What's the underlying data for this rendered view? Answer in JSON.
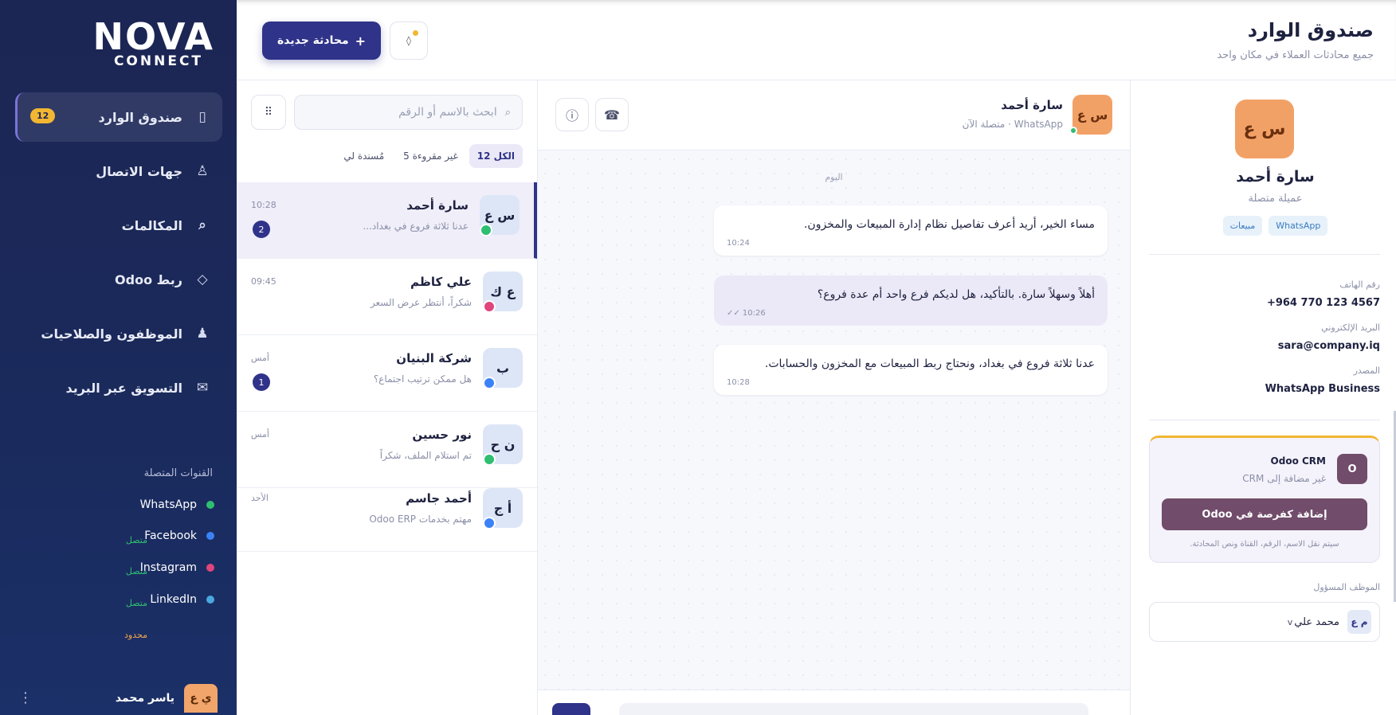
{
  "brand": {
    "line1": "NOVA",
    "line2": "CONNECT"
  },
  "nav": [
    {
      "label": "صندوق الوارد",
      "icon": "▯",
      "badge": "12",
      "active": true
    },
    {
      "label": "جهات الاتصال",
      "icon": "♙"
    },
    {
      "label": "المكالمات",
      "icon": "⌕"
    },
    {
      "label": "ربط Odoo",
      "icon": "◇"
    },
    {
      "label": "الموظفون والصلاحيات",
      "icon": "♟"
    },
    {
      "label": "التسويق عبر البريد",
      "icon": "✉"
    }
  ],
  "channels": {
    "title": "القنوات المتصلة",
    "items": [
      {
        "name": "WhatsApp",
        "status": "متصل",
        "color": "#2fbf71",
        "status_color": "#2fbf71"
      },
      {
        "name": "Facebook",
        "status": "متصل",
        "color": "#3b82f6",
        "status_color": "#2fbf71"
      },
      {
        "name": "Instagram",
        "status": "متصل",
        "color": "#e0457b",
        "status_color": "#2fbf71"
      },
      {
        "name": "LinkedIn",
        "status": "محدود",
        "color": "#4aa8e0",
        "status_color": "#f2a64a"
      }
    ]
  },
  "user": {
    "initials": "ي ع",
    "name": "ياسر محمد"
  },
  "header": {
    "title": "صندوق الوارد",
    "subtitle": "جميع محادثات العملاء في مكان واحد",
    "new_chat": "محادثة جديدة",
    "new_chat_icon": "+"
  },
  "conversations": {
    "search_placeholder": "ابحث بالاسم أو الرقم",
    "tabs": [
      {
        "label": "الكل 12",
        "active": true
      },
      {
        "label": "غير مقروءة 5"
      },
      {
        "label": "مُسندة لي"
      }
    ],
    "items": [
      {
        "initials": "س ع",
        "name": "سارة أحمد",
        "preview": "عدنا ثلاثة فروع في بغداد...",
        "time": "10:28",
        "unread": "2",
        "channel_color": "#2fbf71",
        "active": true
      },
      {
        "initials": "ع ك",
        "name": "علي كاظم",
        "preview": "شكراً، أنتظر عرض السعر",
        "time": "09:45",
        "unread": "",
        "channel_color": "#e0457b"
      },
      {
        "initials": "ب",
        "name": "شركة البنيان",
        "preview": "هل ممكن ترتيب اجتماع؟",
        "time": "أمس",
        "unread": "1",
        "channel_color": "#3b82f6"
      },
      {
        "initials": "ن ح",
        "name": "نور حسين",
        "preview": "تم استلام الملف، شكراً",
        "time": "أمس",
        "unread": "",
        "channel_color": "#2fbf71"
      },
      {
        "initials": "أ ج",
        "name": "أحمد جاسم",
        "preview": "مهتم بخدمات Odoo ERP",
        "time": "الأحد",
        "unread": "",
        "channel_color": "#3b82f6"
      }
    ]
  },
  "chat": {
    "contact_initials": "س ع",
    "contact_name": "سارة أحمد",
    "contact_status": "WhatsApp · متصلة الآن",
    "day_label": "اليوم",
    "messages": [
      {
        "direction": "in",
        "text": "مساء الخير، أريد أعرف تفاصيل نظام إدارة المبيعات والمخزون.",
        "time": "10:24"
      },
      {
        "direction": "out",
        "text": "أهلاً وسهلاً سارة. بالتأكيد، هل لديكم فرع واحد أم عدة فروع؟",
        "time": "✓✓ 10:26"
      },
      {
        "direction": "in",
        "text": "عدنا ثلاثة فروع في بغداد، ونحتاج ربط المبيعات مع المخزون والحسابات.",
        "time": "10:28"
      }
    ]
  },
  "contact": {
    "initials": "س ع",
    "name": "سارة أحمد",
    "role": "عميلة متصلة",
    "tags": [
      "WhatsApp",
      "مبيعات"
    ],
    "phone_label": "رقم الهاتف",
    "phone": "+964 770 123 4567",
    "email_label": "البريد الإلكتروني",
    "email": "sara@company.iq",
    "source_label": "المصدر",
    "source": "WhatsApp Business",
    "crm": {
      "icon": "O",
      "title": "Odoo CRM",
      "subtitle": "غير مضافة إلى CRM",
      "button": "إضافة كفرصة في Odoo",
      "note": "سيتم نقل الاسم، الرقم، القناة ونص المحادثة."
    },
    "assignee_label": "الموظف المسؤول",
    "assignee_initials": "م ع",
    "assignee_name": "محمد علي"
  }
}
